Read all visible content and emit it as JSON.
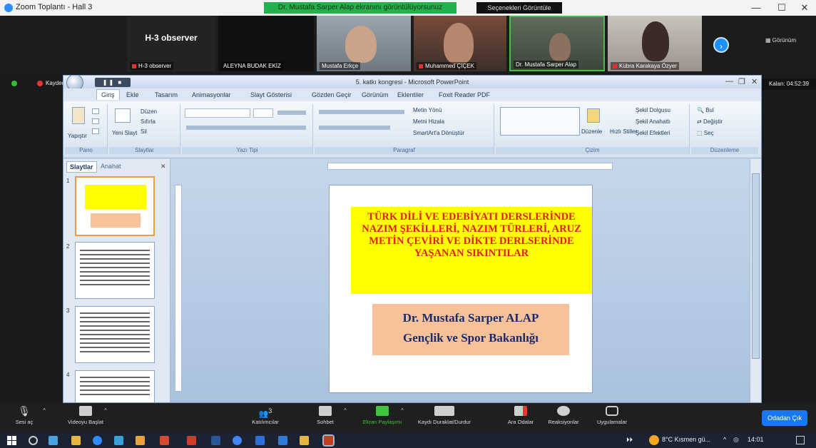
{
  "window": {
    "title": "Zoom Toplantı - Hall 3",
    "sharing_banner": "Dr. Mustafa Sarper Alap ekranını görüntülüyorsunuz",
    "view_options": "Seçenekleri Görüntüle",
    "minimize": "—",
    "maximize": "☐",
    "close": "✕"
  },
  "gallery": {
    "tiles": [
      {
        "name": "H-3 observer",
        "big_label": "H-3 observer"
      },
      {
        "name": "ALEYNA BUDAK EKİZ",
        "big_label": ""
      },
      {
        "name": "Mustafa Erkçe",
        "big_label": ""
      },
      {
        "name": "Muhammed ÇIÇEK",
        "big_label": ""
      },
      {
        "name": "Dr. Mustafa Sarper Alap",
        "big_label": ""
      },
      {
        "name": "Kübra Karakaya Özyer",
        "big_label": ""
      }
    ],
    "next_arrow": "›",
    "view_label": "Görünüm"
  },
  "recording": {
    "label": "Kaydediliyor..."
  },
  "remaining": {
    "label": "Kalan: 04:52:39"
  },
  "ppt": {
    "title": "5. katkı kongresi - Microsoft PowerPoint",
    "pause_controls": "❚❚ ■",
    "tabs": [
      "Giriş",
      "Ekle",
      "Tasarım",
      "Animasyonlar",
      "Slayt Gösterisi",
      "Gözden Geçir",
      "Görünüm",
      "Eklentiler",
      "Foxit Reader PDF"
    ],
    "ribbon_groups": {
      "clipboard": {
        "label": "Pano",
        "paste": "Yapıştır"
      },
      "slides": {
        "label": "Slaytlar",
        "new_slide": "Yeni Slayt",
        "layout": "Düzen",
        "reset": "Sıfırla",
        "delete": "Sil"
      },
      "font": {
        "label": "Yazı Tipi"
      },
      "paragraph": {
        "label": "Paragraf",
        "text_direction": "Metin Yönü",
        "align_text": "Metni Hizala",
        "smartart": "SmartArt'a Dönüştür"
      },
      "drawing": {
        "label": "Çizim",
        "arrange": "Düzenle",
        "quick_styles": "Hızlı Stiller",
        "shape_fill": "Şekil Dolgusu",
        "shape_outline": "Şekil Anahattı",
        "shape_effects": "Şekil Efektleri"
      },
      "editing": {
        "label": "Düzenleme",
        "find": "Bul",
        "replace": "Değiştir",
        "select": "Seç"
      }
    },
    "pane": {
      "tab_slides": "Slaytlar",
      "tab_outline": "Anahat",
      "close": "✕",
      "slide_numbers": [
        "1",
        "2",
        "3",
        "4"
      ]
    },
    "slide": {
      "title": "TÜRK DİLİ VE EDEBİYATI DERSLERİNDE NAZIM ŞEKİLLERİ, NAZIM TÜRLERİ, ARUZ METİN ÇEVİRİ VE DİKTE DERLSERİNDE YAŞANAN SIKINTILAR",
      "author_line1": "Dr. Mustafa Sarper ALAP",
      "author_line2": "Gençlik ve Spor Bakanlığı"
    }
  },
  "controls": {
    "items": [
      {
        "label": "Sesi aç"
      },
      {
        "label": "Videoyu Başlat"
      },
      {
        "label": "Katılımcılar"
      },
      {
        "label": "Sohbet"
      },
      {
        "label": "Ekran Paylaşımı"
      },
      {
        "label": "Kaydı Duraklat/Durdur"
      },
      {
        "label": "Ara Odalar"
      },
      {
        "label": "Reaksiyonlar"
      },
      {
        "label": "Uygulamalar"
      }
    ],
    "participants_count": "3",
    "leave": "Odadan Çık"
  },
  "taskbar": {
    "weather": "8°C Kısmen gü...",
    "time": "14:01"
  },
  "colors": {
    "zoom_blue": "#1877f2",
    "sharing_green": "#22b14c",
    "slide_yellow": "#ffff00",
    "slide_red_text": "#e02020",
    "slide_peach": "#f7c29a"
  }
}
